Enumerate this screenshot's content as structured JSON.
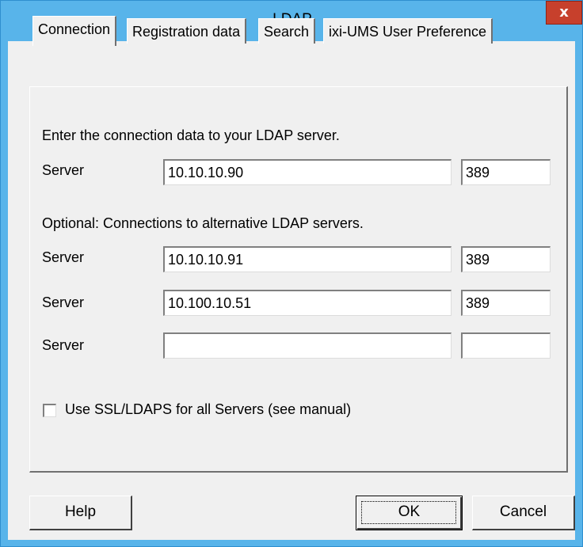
{
  "window": {
    "title": "LDAP",
    "close_label": "x"
  },
  "tabs": [
    {
      "label": "Connection",
      "active": true
    },
    {
      "label": "Registration data",
      "active": false
    },
    {
      "label": "Search",
      "active": false
    },
    {
      "label": "ixi-UMS User Preference",
      "active": false
    }
  ],
  "connection": {
    "intro": "Enter the connection data to your LDAP server.",
    "server_label": "Server",
    "primary": {
      "host": "10.10.10.90",
      "port": "389"
    },
    "optional_intro": "Optional: Connections to alternative LDAP servers.",
    "alternatives": [
      {
        "host": "10.10.10.91",
        "port": "389"
      },
      {
        "host": "10.100.10.51",
        "port": "389"
      },
      {
        "host": "",
        "port": ""
      }
    ],
    "ssl_label": "Use SSL/LDAPS for all Servers (see manual)",
    "ssl_checked": false
  },
  "buttons": {
    "help": "Help",
    "ok": "OK",
    "cancel": "Cancel"
  }
}
